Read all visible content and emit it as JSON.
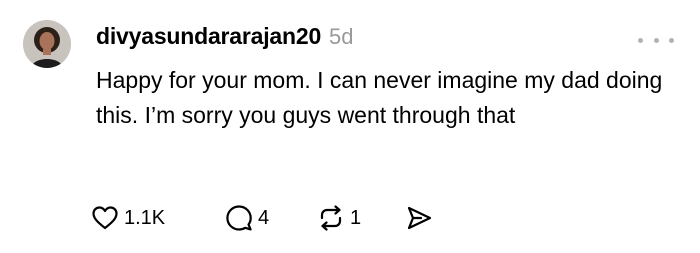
{
  "post": {
    "username": "divyasundararajan20",
    "timestamp": "5d",
    "text": "Happy for your mom. I can never imagine my dad doing this. I’m sorry you guys went through that",
    "avatar_icon": "user-avatar",
    "more_icon": "more-options-icon"
  },
  "actions": {
    "like": {
      "icon": "heart-icon",
      "count": "1.1K"
    },
    "reply": {
      "icon": "comment-bubble-icon",
      "count": "4"
    },
    "repost": {
      "icon": "repost-icon",
      "count": "1"
    },
    "share": {
      "icon": "send-icon"
    }
  },
  "colors": {
    "text": "#000000",
    "muted": "#999999",
    "background": "#ffffff"
  }
}
